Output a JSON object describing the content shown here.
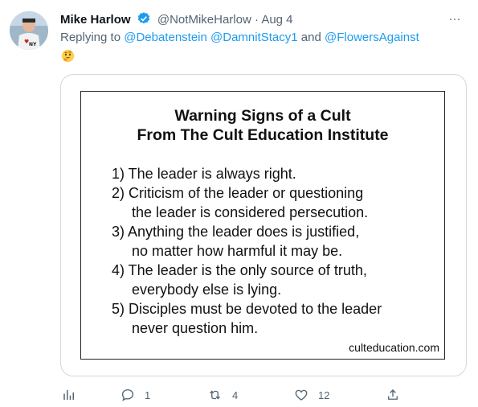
{
  "tweet": {
    "author_name": "Mike Harlow",
    "author_handle": "@NotMikeHarlow",
    "separator": "·",
    "date": "Aug 4",
    "reply_prefix": "Replying to",
    "reply_users": [
      "@Debatenstein",
      "@DamnitStacy1",
      "@FlowersAgainst"
    ],
    "reply_conjunction": "and",
    "reply_text_emoji": "thinking-face-emoji",
    "more_label": "···"
  },
  "image": {
    "title_line1": "Warning Signs of a Cult",
    "title_line2": "From The Cult Education Institute",
    "items": [
      [
        "1) The leader is always right."
      ],
      [
        "2) Criticism of the leader or questioning",
        "the leader is considered persecution."
      ],
      [
        "3) Anything the leader does is justified,",
        "no matter how harmful it may be."
      ],
      [
        "4) The leader is the only source of truth,",
        "everybody else is lying."
      ],
      [
        "5) Disciples must be devoted to the leader",
        "never question him."
      ]
    ],
    "source": "culteducation.com"
  },
  "actions": {
    "replies": "1",
    "retweets": "4",
    "likes": "12"
  },
  "colors": {
    "link": "#1d9bf0",
    "secondary": "#536471",
    "border": "#cfd9de"
  }
}
